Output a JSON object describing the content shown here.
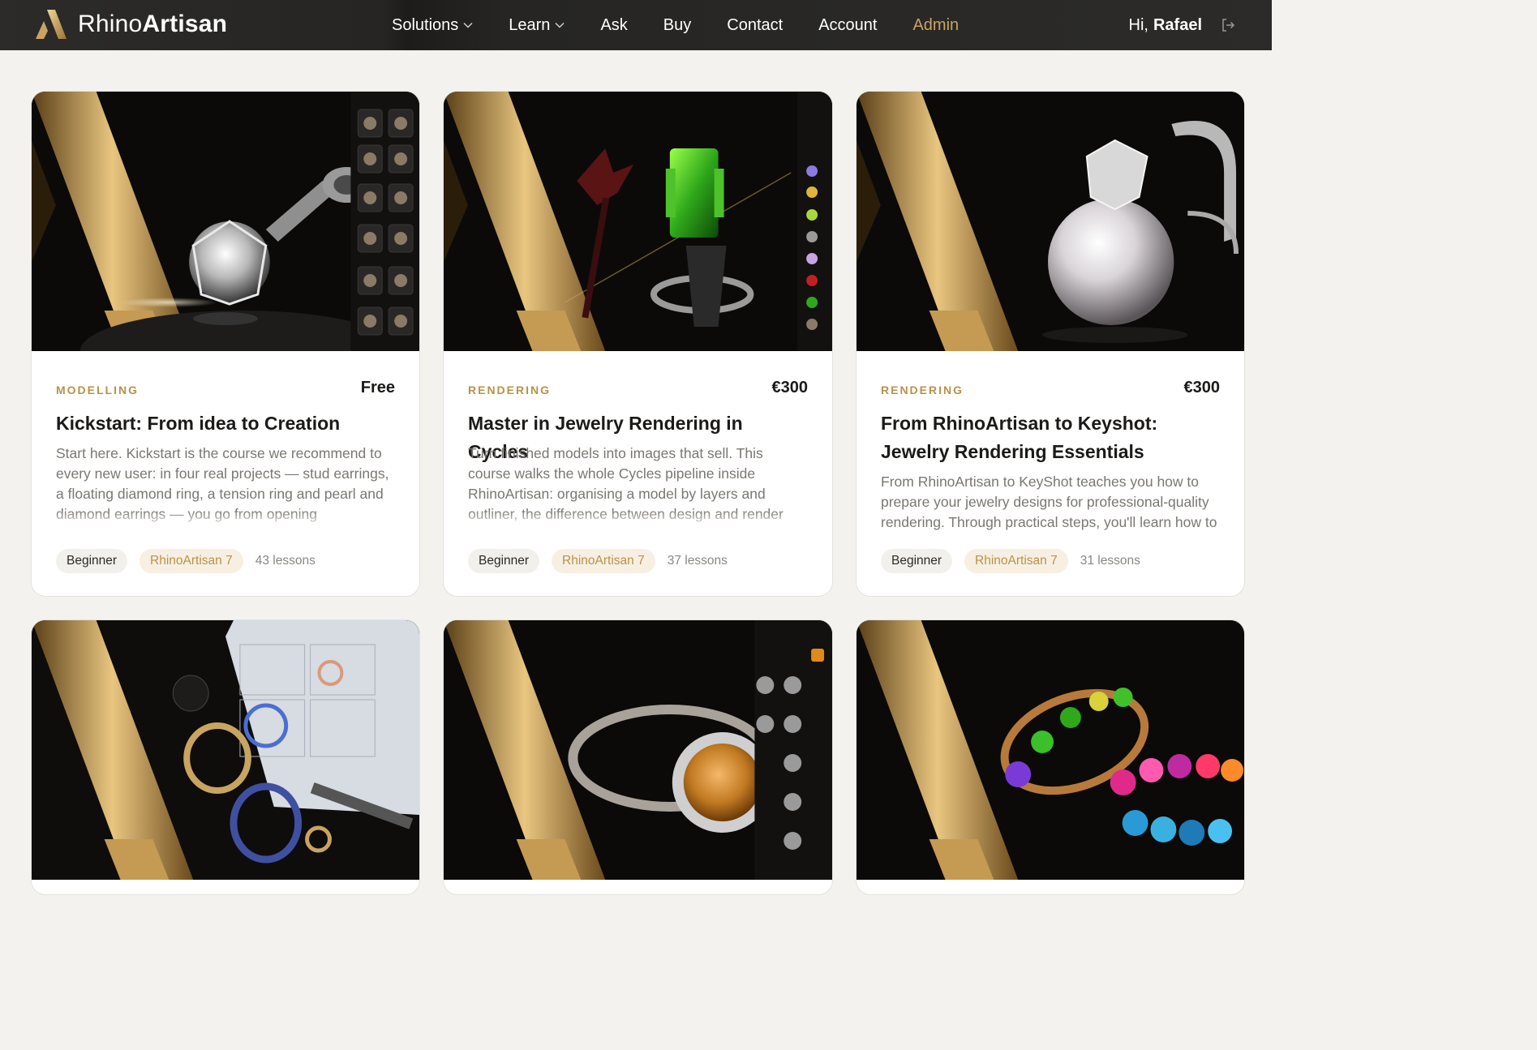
{
  "brand": {
    "light": "Rhino",
    "bold": "Artisan"
  },
  "nav": {
    "items": [
      {
        "label": "Solutions",
        "dropdown": true
      },
      {
        "label": "Learn",
        "dropdown": true
      },
      {
        "label": "Ask",
        "dropdown": false
      },
      {
        "label": "Buy",
        "dropdown": false
      },
      {
        "label": "Contact",
        "dropdown": false
      },
      {
        "label": "Account",
        "dropdown": false
      },
      {
        "label": "Admin",
        "dropdown": false
      }
    ],
    "greeting": "Hi,",
    "user_name": "Rafael"
  },
  "colors": {
    "accent": "#c9a461",
    "category": "#b8924a",
    "nav_bg": "#2c2b29",
    "page_bg": "#f3f2ee"
  },
  "courses": [
    {
      "category": "MODELLING",
      "price": "Free",
      "title": "Kickstart: From idea to Creation",
      "description": "Start here. Kickstart is the course we recommend to every new user: in four real projects — stud earrings, a floating diamond ring, a tension ring and pearl and diamond earrings — you go from opening RhinoArtisan for the first time to finishing pieces you",
      "level": "Beginner",
      "software": "RhinoArtisan 7",
      "lessons": "43 lessons",
      "image": "stud-earring-render"
    },
    {
      "category": "RENDERING",
      "price": "€300",
      "title": "Master in Jewelry Rendering in Cycles",
      "description": "Turn finished models into images that sell. This course walks the whole Cycles pipeline inside RhinoArtisan: organising a model by layers and outliner, the difference between design and render materials, posing pieces on the ground and in pairs",
      "level": "Beginner",
      "software": "RhinoArtisan 7",
      "lessons": "37 lessons",
      "image": "emerald-ring-render"
    },
    {
      "category": "RENDERING",
      "price": "€300",
      "title": "From RhinoArtisan to Keyshot: Jewelry Rendering Essentials",
      "description": "From RhinoArtisan to KeyShot teaches you how to prepare your jewelry designs for professional-quality rendering. Through practical steps, you'll learn how to",
      "level": "Beginner",
      "software": "RhinoArtisan 7",
      "lessons": "31 lessons",
      "image": "pearl-earring-render"
    },
    {
      "image": "technical-sheet-rings"
    },
    {
      "image": "halo-citrine-ring"
    },
    {
      "image": "gemstone-eternity-bands"
    }
  ]
}
